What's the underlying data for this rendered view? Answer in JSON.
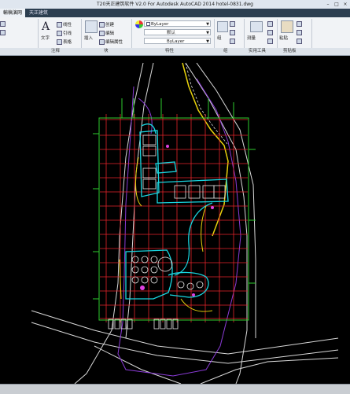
{
  "window": {
    "title": "T20天正建筑软件 V2.0 For Autodesk AutoCAD 2014    hotel-0831.dwg"
  },
  "tabs": [
    "輸稿演网",
    "天正建筑"
  ],
  "ribbon": {
    "text_label": "文字",
    "linear_label": "线性",
    "leader_label": "引线",
    "table_label": "表格",
    "insert_label": "插入",
    "create_label": "创建",
    "edit_label": "编辑",
    "edit_attr_label": "编辑属性",
    "layer_combo": "ByLayer",
    "default_combo": "默认",
    "linetype_combo": "ByLayer",
    "group_label": "组",
    "measure_label": "测量",
    "paste_label": "粘贴"
  },
  "panels": {
    "annotation": "注释",
    "block": "块",
    "properties": "特性",
    "group": "组",
    "utilities": "实用工具",
    "clipboard": "剪贴板"
  },
  "colors": {
    "grid_red": "#e4232a",
    "grid_green": "#2ecc2e",
    "cyan": "#18d6e0",
    "magenta": "#8a3bd6",
    "yellow": "#e8d20c",
    "white": "#d9d9d9"
  }
}
